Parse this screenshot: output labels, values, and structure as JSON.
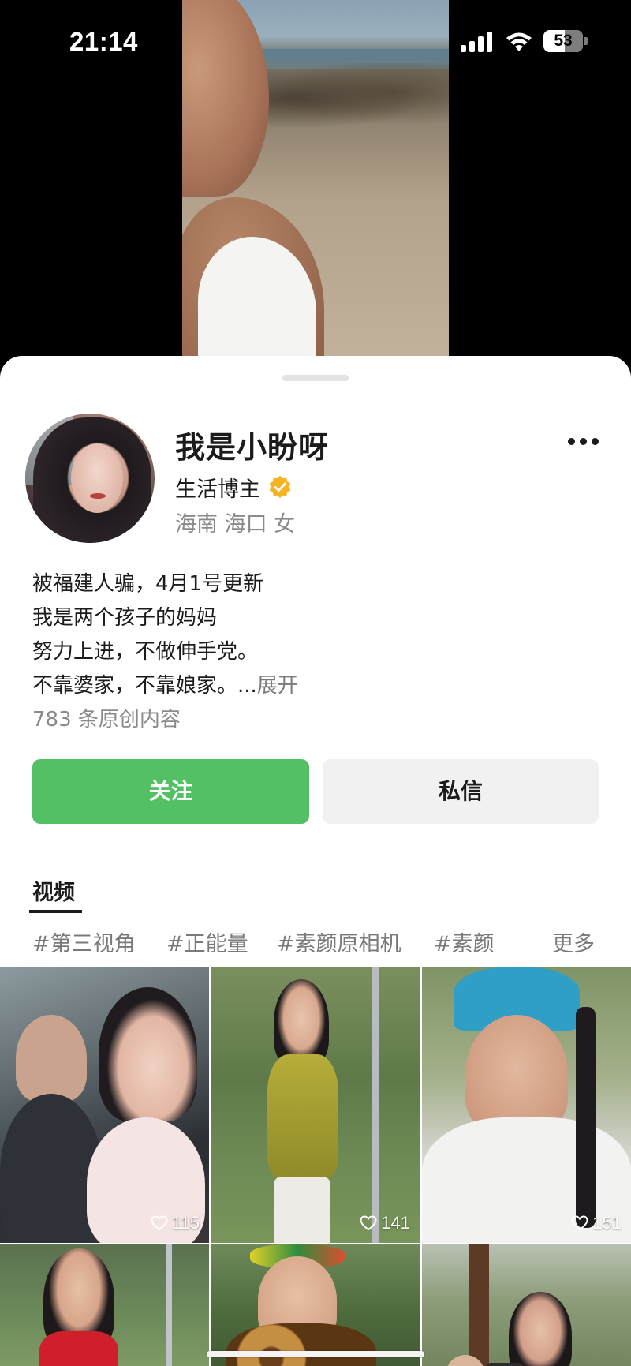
{
  "status_bar": {
    "time": "21:14",
    "battery_level": "53",
    "icons": [
      "signal-icon",
      "wifi-icon",
      "battery-icon"
    ]
  },
  "profile": {
    "username": "我是小盼呀",
    "role": "生活博主",
    "verified": true,
    "location": "海南 海口 女",
    "bio_lines": [
      "被福建人骗，4月1号更新",
      "我是两个孩子的妈妈",
      "努力上进，不做伸手党。",
      "不靠婆家，不靠娘家。..."
    ],
    "expand_label": "展开",
    "content_count": "783 条原创内容"
  },
  "actions": {
    "follow_label": "关注",
    "message_label": "私信"
  },
  "tabs": {
    "videos_label": "视频"
  },
  "tags": [
    "#第三视角",
    "#正能量",
    "#素颜原相机",
    "#素颜"
  ],
  "more_label": "更多",
  "videos": [
    {
      "likes": "115"
    },
    {
      "likes": "141"
    },
    {
      "likes": "151"
    },
    {
      "likes": ""
    },
    {
      "likes": ""
    },
    {
      "likes": ""
    }
  ],
  "colors": {
    "follow_green": "#53c063",
    "verified_gold": "#f5b324",
    "text_primary": "#1b1b1b",
    "text_secondary": "#8a8a8a"
  }
}
